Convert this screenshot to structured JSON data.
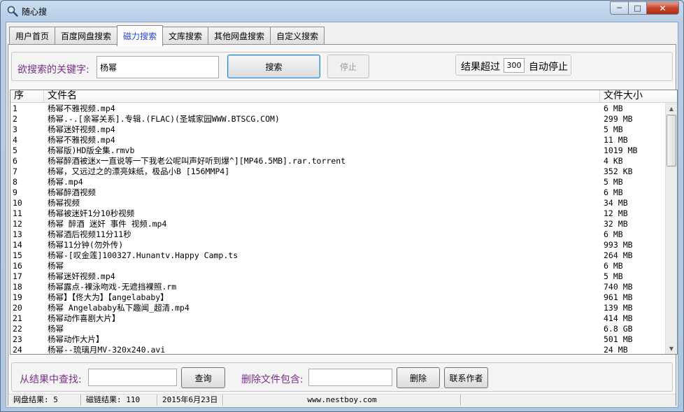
{
  "window": {
    "title": "随心搜",
    "min": "─",
    "max": "□",
    "close": "✕"
  },
  "tabs": [
    {
      "label": "用户首页",
      "active": false
    },
    {
      "label": "百度网盘搜索",
      "active": false
    },
    {
      "label": "磁力搜索",
      "active": true
    },
    {
      "label": "文库搜索",
      "active": false
    },
    {
      "label": "其他网盘搜索",
      "active": false
    },
    {
      "label": "自定义搜索",
      "active": false
    }
  ],
  "search": {
    "label": "欲搜索的关键字:",
    "value": "杨幂",
    "search_button": "搜索",
    "stop_button": "停止",
    "limit_prefix": "结果超过",
    "limit_value": "300",
    "limit_suffix": "自动停止"
  },
  "table": {
    "columns": [
      "序",
      "文件名",
      "文件大小"
    ],
    "rows": [
      [
        "1",
        "杨幂不雅视频.mp4",
        "6 MB"
      ],
      [
        "2",
        "杨幂.-.[亲幂关系].专辑.(FLAC)(圣城家园WWW.BTSCG.COM)",
        "299 MB"
      ],
      [
        "3",
        "杨幂迷奸视频.mp4",
        "5 MB"
      ],
      [
        "4",
        "杨幂不雅视频.mp4",
        "11 MB"
      ],
      [
        "5",
        "杨幂版)HD版全集.rmvb",
        "1019 MB"
      ],
      [
        "6",
        "杨幂醉酒被迷x一直说等一下我老公呢叫声好听到爆^][MP46.5MB].rar.torrent",
        "4 KB"
      ],
      [
        "7",
        "杨幂，又远过之的漂亮妹纸，极品小B [156MMP4]",
        "352 KB"
      ],
      [
        "8",
        "杨幂.mp4",
        "5 MB"
      ],
      [
        "9",
        "杨幂醉酒视频",
        "6 MB"
      ],
      [
        "10",
        "杨幂视频",
        "34 MB"
      ],
      [
        "11",
        "杨幂被迷奸1分10秒视频",
        "12 MB"
      ],
      [
        "12",
        "杨幂 醉酒 迷奸 事件 视频.mp4",
        "32 MB"
      ],
      [
        "13",
        "杨幂酒后视频11分11秒",
        "6 MB"
      ],
      [
        "14",
        "杨幂11分钟(勿外传)",
        "993 MB"
      ],
      [
        "15",
        "杨幂-[叹金莲]100327.Hunantv.Happy Camp.ts",
        "264 MB"
      ],
      [
        "16",
        "杨幂",
        "6 MB"
      ],
      [
        "17",
        "杨幂迷奸视频.mp4",
        "5 MB"
      ],
      [
        "18",
        "杨幂露点-裸泳吻戏-无遮挡裸照.rm",
        "740 MB"
      ],
      [
        "19",
        "杨幂】【佟大为】【angelababy】",
        "961 MB"
      ],
      [
        "20",
        "杨幂 Angelababy私下趣闻_超清.mp4",
        "139 MB"
      ],
      [
        "21",
        "杨幂动作喜剧大片】",
        "414 MB"
      ],
      [
        "22",
        "杨幂",
        "6.8 GB"
      ],
      [
        "23",
        "杨幂动作大片】",
        "501 MB"
      ],
      [
        "24",
        "杨幂--琉璃月MV-320x240.avi",
        "24 MB"
      ]
    ]
  },
  "filter": {
    "find_label": "从结果中查找:",
    "find_value": "",
    "query_button": "查询",
    "exclude_label": "删除文件包含:",
    "exclude_value": "",
    "delete_button": "删除",
    "contact_button": "联系作者"
  },
  "status": {
    "pan_results": "网盘结果: 5",
    "magnet_results": "磁链结果: 110",
    "date": "2015年6月23日",
    "site": "www.nestboy.com",
    "extra": ""
  }
}
